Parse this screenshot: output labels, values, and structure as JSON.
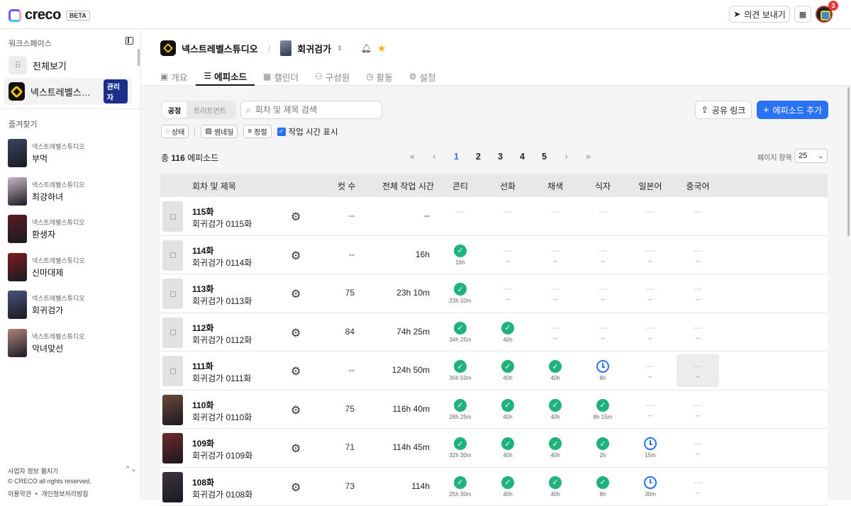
{
  "app": {
    "brand": "creco",
    "beta": "BETA",
    "feedback": "의견 보내기",
    "notifications": "3"
  },
  "sidebar": {
    "workspace_heading": "워크스페이스",
    "workspaces": [
      {
        "label": "전체보기"
      },
      {
        "label": "넥스트레벨스튜디오",
        "role": "관리자"
      }
    ],
    "favorites_heading": "즐겨찾기",
    "favorites": [
      {
        "studio": "넥스트레벨스튜디오",
        "title": "부먹",
        "color": "#3a4460"
      },
      {
        "studio": "넥스트레벨스튜디오",
        "title": "최강하녀",
        "color": "#c9b9c4"
      },
      {
        "studio": "넥스트레벨스튜디오",
        "title": "환생자",
        "color": "#5a1c22"
      },
      {
        "studio": "넥스트레벨스튜디오",
        "title": "신마대제",
        "color": "#7a1e1e"
      },
      {
        "studio": "넥스트레벨스튜디오",
        "title": "회귀검가",
        "color": "#4b5278"
      },
      {
        "studio": "넥스트레벨스튜디오",
        "title": "악녀맞선",
        "color": "#b0847a"
      }
    ],
    "footer": {
      "biz_info": "사업자 정보 펼치기",
      "copyright": "© CRECO all rights reserved.",
      "terms": "이용약관",
      "dot": "•",
      "privacy": "개인정보처리방침"
    }
  },
  "header": {
    "studio": "넥스트레벨스튜디오",
    "project": "회귀검가",
    "tabs": [
      {
        "label": "개요",
        "icon": "▣"
      },
      {
        "label": "에피소드",
        "icon": "☰"
      },
      {
        "label": "캘린더",
        "icon": "▦"
      },
      {
        "label": "구성원",
        "icon": "⚇"
      },
      {
        "label": "활동",
        "icon": "◷"
      },
      {
        "label": "설정",
        "icon": "⚙"
      }
    ]
  },
  "toolbar": {
    "seg_on": "공정",
    "seg_off": "트리트먼트",
    "search_placeholder": "회차 및 제목 검색",
    "share": "공유 링크",
    "add": "에피소드 추가",
    "filters": {
      "status": "상태",
      "thumbnail": "썸네일",
      "sort": "정렬",
      "show_time": "작업 시간 표시"
    }
  },
  "summary": {
    "prefix": "총",
    "count": "116",
    "suffix": "에피소드"
  },
  "pager": {
    "first": "«",
    "prev": "‹",
    "pages": [
      "1",
      "2",
      "3",
      "4",
      "5"
    ],
    "next": "›",
    "last": "»",
    "per_page_label": "페이지 항목",
    "per_page": "25"
  },
  "table": {
    "headers": {
      "title": "회차 및 제목",
      "cuts": "컷 수",
      "time": "전체 작업 시간",
      "stages": [
        "콘티",
        "선화",
        "채색",
        "식자",
        "일본어",
        "중국어"
      ]
    },
    "rows": [
      {
        "ep": "115화",
        "title": "회귀검가 0115화",
        "cuts": "--",
        "time": "--",
        "thumb": "",
        "stages": [
          [
            "dash",
            ""
          ],
          [
            "dash",
            ""
          ],
          [
            "dash",
            ""
          ],
          [
            "dash",
            ""
          ],
          [
            "dash",
            ""
          ],
          [
            "dash",
            ""
          ]
        ]
      },
      {
        "ep": "114화",
        "title": "회귀검가 0114화",
        "cuts": "--",
        "time": "16h",
        "thumb": "",
        "stages": [
          [
            "done",
            "16h"
          ],
          [
            "dash",
            "--"
          ],
          [
            "dash",
            "--"
          ],
          [
            "dash",
            "--"
          ],
          [
            "dash",
            "--"
          ],
          [
            "dash",
            "--"
          ]
        ]
      },
      {
        "ep": "113화",
        "title": "회귀검가 0113화",
        "cuts": "75",
        "time": "23h 10m",
        "thumb": "",
        "stages": [
          [
            "done",
            "23h 10m"
          ],
          [
            "dash",
            "--"
          ],
          [
            "dash",
            "--"
          ],
          [
            "dash",
            "--"
          ],
          [
            "dash",
            "--"
          ],
          [
            "dash",
            "--"
          ]
        ]
      },
      {
        "ep": "112화",
        "title": "회귀검가 0112화",
        "cuts": "84",
        "time": "74h 25m",
        "thumb": "",
        "stages": [
          [
            "done",
            "34h 25m"
          ],
          [
            "done",
            "40h"
          ],
          [
            "dash",
            "--"
          ],
          [
            "dash",
            "--"
          ],
          [
            "dash",
            "--"
          ],
          [
            "dash",
            "--"
          ]
        ]
      },
      {
        "ep": "111화",
        "title": "회귀검가 0111화",
        "cuts": "--",
        "time": "124h 50m",
        "thumb": "",
        "stages": [
          [
            "done",
            "36h 50m"
          ],
          [
            "done",
            "40h"
          ],
          [
            "done",
            "40h"
          ],
          [
            "clock",
            "8h"
          ],
          [
            "dash",
            "--"
          ],
          [
            "dash",
            "--"
          ]
        ]
      },
      {
        "ep": "110화",
        "title": "회귀검가 0110화",
        "cuts": "75",
        "time": "116h 40m",
        "thumb": "#6a4a3a",
        "stages": [
          [
            "done",
            "28h 25m"
          ],
          [
            "done",
            "40h"
          ],
          [
            "done",
            "40h"
          ],
          [
            "done",
            "8h 15m"
          ],
          [
            "dash",
            "--"
          ],
          [
            "dash",
            "--"
          ]
        ]
      },
      {
        "ep": "109화",
        "title": "회귀검가 0109화",
        "cuts": "71",
        "time": "114h 45m",
        "thumb": "#6e2a2a",
        "stages": [
          [
            "done",
            "32h 30m"
          ],
          [
            "done",
            "40h"
          ],
          [
            "done",
            "40h"
          ],
          [
            "done",
            "2h"
          ],
          [
            "clock",
            "15m"
          ],
          [
            "dash",
            "--"
          ]
        ]
      },
      {
        "ep": "108화",
        "title": "회귀검가 0108화",
        "cuts": "73",
        "time": "114h",
        "thumb": "#3a3440",
        "stages": [
          [
            "done",
            "25h 30m"
          ],
          [
            "done",
            "40h"
          ],
          [
            "done",
            "40h"
          ],
          [
            "done",
            "8h"
          ],
          [
            "clock",
            "30m"
          ],
          [
            "dash",
            "--"
          ]
        ]
      }
    ]
  }
}
